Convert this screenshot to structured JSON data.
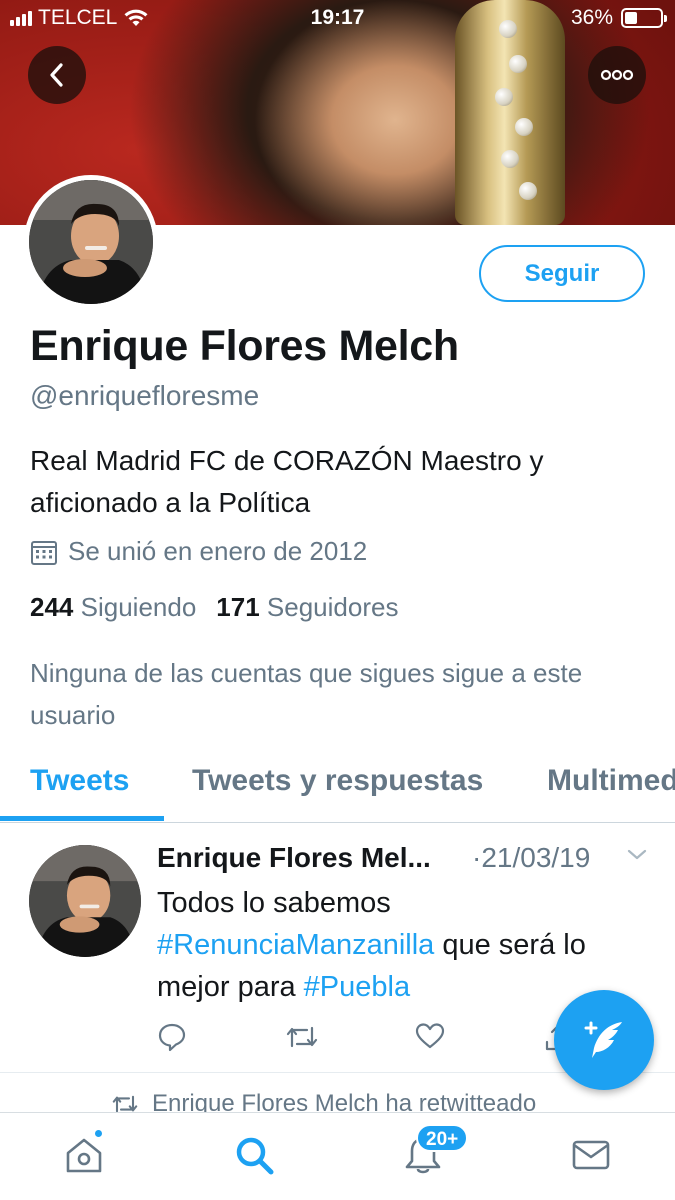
{
  "status_bar": {
    "carrier": "TELCEL",
    "time": "19:17",
    "battery": "36%",
    "battery_level": 0.36
  },
  "header": {
    "back_icon": "chevron-left-icon",
    "more_icon": "more-dots-icon"
  },
  "profile": {
    "follow_label": "Seguir",
    "name": "Enrique Flores Melch",
    "handle": "@enriquefloresme",
    "bio": "Real Madrid FC de CORAZÓN Maestro y aficionado a la Política",
    "joined": "Se unió en enero de 2012",
    "following_count": "244",
    "following_label": "Siguiendo",
    "followers_count": "171",
    "followers_label": "Seguidores",
    "no_mutuals": "Ninguna de las cuentas que sigues sigue a este usuario"
  },
  "tabs": [
    {
      "label": "Tweets",
      "active": true
    },
    {
      "label": "Tweets y respuestas",
      "active": false
    },
    {
      "label": "Multimedia",
      "active": false
    }
  ],
  "tweet": {
    "author": "Enrique Flores Mel...",
    "date": "·21/03/19",
    "text_1": "Todos lo sabemos",
    "hashtag_1": "#RenunciaManzanilla",
    "text_2": " que será lo mejor para ",
    "hashtag_2": "#Puebla"
  },
  "retweet_row": {
    "text": "Enrique Flores Melch ha retwitteado"
  },
  "bottom_nav": {
    "notifications_badge": "20+"
  },
  "colors": {
    "accent": "#1da1f2",
    "secondary_text": "#657786",
    "primary_text": "#14171a"
  }
}
